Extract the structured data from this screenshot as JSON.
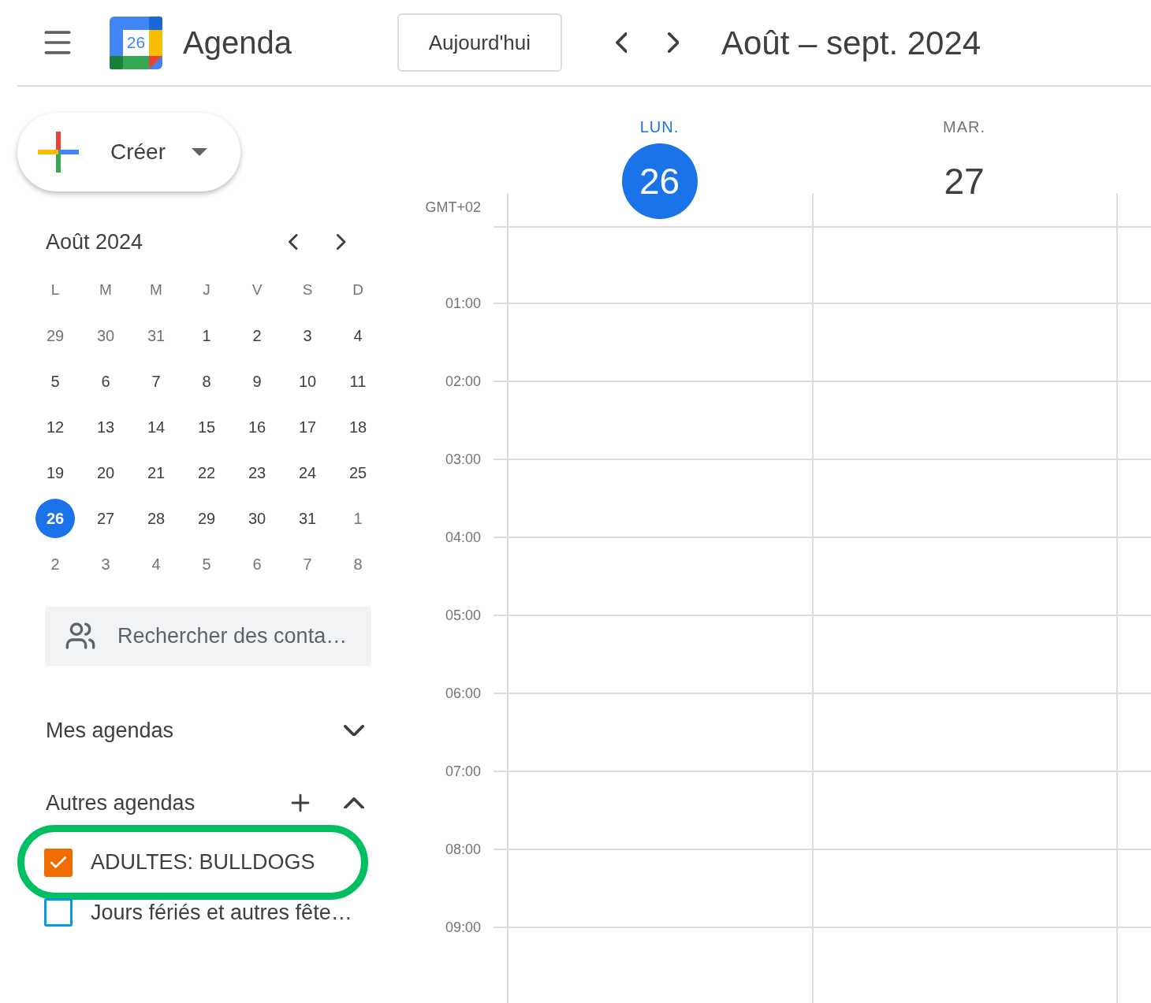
{
  "header": {
    "logo_day": "26",
    "app_name": "Agenda",
    "today_button": "Aujourd'hui",
    "date_range": "Août – sept. 2024"
  },
  "create_button": {
    "label": "Créer"
  },
  "mini_calendar": {
    "month": "Août 2024",
    "weekdays": [
      "L",
      "M",
      "M",
      "J",
      "V",
      "S",
      "D"
    ],
    "weeks": [
      [
        {
          "day": "29",
          "outside": true,
          "selected": false
        },
        {
          "day": "30",
          "outside": true,
          "selected": false
        },
        {
          "day": "31",
          "outside": true,
          "selected": false
        },
        {
          "day": "1",
          "outside": false,
          "selected": false
        },
        {
          "day": "2",
          "outside": false,
          "selected": false
        },
        {
          "day": "3",
          "outside": false,
          "selected": false
        },
        {
          "day": "4",
          "outside": false,
          "selected": false
        }
      ],
      [
        {
          "day": "5",
          "outside": false,
          "selected": false
        },
        {
          "day": "6",
          "outside": false,
          "selected": false
        },
        {
          "day": "7",
          "outside": false,
          "selected": false
        },
        {
          "day": "8",
          "outside": false,
          "selected": false
        },
        {
          "day": "9",
          "outside": false,
          "selected": false
        },
        {
          "day": "10",
          "outside": false,
          "selected": false
        },
        {
          "day": "11",
          "outside": false,
          "selected": false
        }
      ],
      [
        {
          "day": "12",
          "outside": false,
          "selected": false
        },
        {
          "day": "13",
          "outside": false,
          "selected": false
        },
        {
          "day": "14",
          "outside": false,
          "selected": false
        },
        {
          "day": "15",
          "outside": false,
          "selected": false
        },
        {
          "day": "16",
          "outside": false,
          "selected": false
        },
        {
          "day": "17",
          "outside": false,
          "selected": false
        },
        {
          "day": "18",
          "outside": false,
          "selected": false
        }
      ],
      [
        {
          "day": "19",
          "outside": false,
          "selected": false
        },
        {
          "day": "20",
          "outside": false,
          "selected": false
        },
        {
          "day": "21",
          "outside": false,
          "selected": false
        },
        {
          "day": "22",
          "outside": false,
          "selected": false
        },
        {
          "day": "23",
          "outside": false,
          "selected": false
        },
        {
          "day": "24",
          "outside": false,
          "selected": false
        },
        {
          "day": "25",
          "outside": false,
          "selected": false
        }
      ],
      [
        {
          "day": "26",
          "outside": false,
          "selected": true
        },
        {
          "day": "27",
          "outside": false,
          "selected": false
        },
        {
          "day": "28",
          "outside": false,
          "selected": false
        },
        {
          "day": "29",
          "outside": false,
          "selected": false
        },
        {
          "day": "30",
          "outside": false,
          "selected": false
        },
        {
          "day": "31",
          "outside": false,
          "selected": false
        },
        {
          "day": "1",
          "outside": true,
          "selected": false
        }
      ],
      [
        {
          "day": "2",
          "outside": true,
          "selected": false
        },
        {
          "day": "3",
          "outside": true,
          "selected": false
        },
        {
          "day": "4",
          "outside": true,
          "selected": false
        },
        {
          "day": "5",
          "outside": true,
          "selected": false
        },
        {
          "day": "6",
          "outside": true,
          "selected": false
        },
        {
          "day": "7",
          "outside": true,
          "selected": false
        },
        {
          "day": "8",
          "outside": true,
          "selected": false
        }
      ]
    ]
  },
  "people_search": {
    "placeholder": "Rechercher des conta…"
  },
  "my_calendars": {
    "title": "Mes agendas",
    "expanded": false
  },
  "other_calendars": {
    "title": "Autres agendas",
    "expanded": true,
    "items": [
      {
        "name": "ADULTES: BULLDOGS",
        "checked": true,
        "color": "#ef6c00",
        "highlighted": true
      },
      {
        "name": "Jours fériés et autres fête…",
        "checked": false,
        "color": "#039be5",
        "highlighted": false
      }
    ]
  },
  "timezone": "GMT+02",
  "days": [
    {
      "weekday": "LUN.",
      "date": "26",
      "selected": true
    },
    {
      "weekday": "MAR.",
      "date": "27",
      "selected": false
    }
  ],
  "hours": [
    "01:00",
    "02:00",
    "03:00",
    "04:00",
    "05:00",
    "06:00",
    "07:00",
    "08:00",
    "09:00"
  ]
}
